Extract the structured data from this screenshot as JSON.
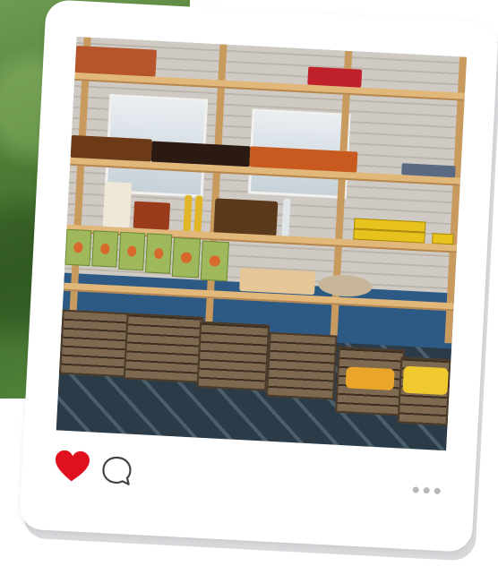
{
  "post": {
    "like_icon": "heart-icon",
    "comment_icon": "comment-icon",
    "more_icon": "more-options-icon",
    "liked": true
  },
  "colors": {
    "heart": "#e0101e",
    "card": "#ffffff",
    "background_foliage": "#4f7d36"
  }
}
